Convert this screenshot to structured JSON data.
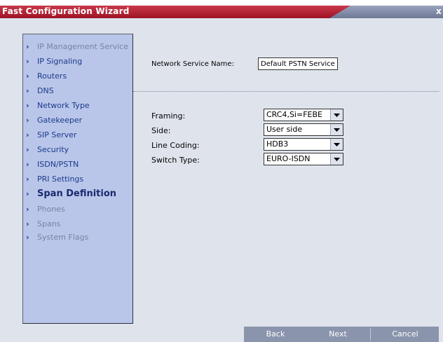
{
  "window": {
    "title": "Fast Configuration Wizard",
    "close_label": "x"
  },
  "sidebar": {
    "items": [
      {
        "label": "IP Management Service",
        "state": "disabled"
      },
      {
        "label": "IP Signaling",
        "state": "normal"
      },
      {
        "label": "Routers",
        "state": "normal"
      },
      {
        "label": "DNS",
        "state": "normal"
      },
      {
        "label": "Network Type",
        "state": "normal"
      },
      {
        "label": "Gatekeeper",
        "state": "normal"
      },
      {
        "label": "SIP Server",
        "state": "normal"
      },
      {
        "label": "Security",
        "state": "normal"
      },
      {
        "label": "ISDN/PSTN",
        "state": "normal"
      },
      {
        "label": "PRI Settings",
        "state": "normal"
      },
      {
        "label": "Span Definition",
        "state": "active"
      },
      {
        "label": "Phones",
        "state": "disabled"
      },
      {
        "label": "Spans",
        "state": "disabled"
      },
      {
        "label": "System Flags",
        "state": "disabled"
      }
    ]
  },
  "form": {
    "service_name_label": "Network Service Name:",
    "service_name_value": "Default PSTN Service",
    "framing_label": "Framing:",
    "framing_value": "CRC4,Si=FEBE",
    "side_label": "Side:",
    "side_value": "User side",
    "line_coding_label": "Line Coding:",
    "line_coding_value": "HDB3",
    "switch_type_label": "Switch Type:",
    "switch_type_value": "EURO-ISDN"
  },
  "buttons": {
    "back": "Back",
    "next": "Next",
    "cancel": "Cancel"
  },
  "colors": {
    "titlebar": "#b01f33",
    "sidebar": "#b9c6ea",
    "content": "#dfe4ec",
    "link": "#1c3a8a",
    "buttons": "#8a94ac"
  },
  "icons": {
    "nav_arrow": "chevron-right-icon",
    "dropdown": "chevron-down-icon"
  }
}
